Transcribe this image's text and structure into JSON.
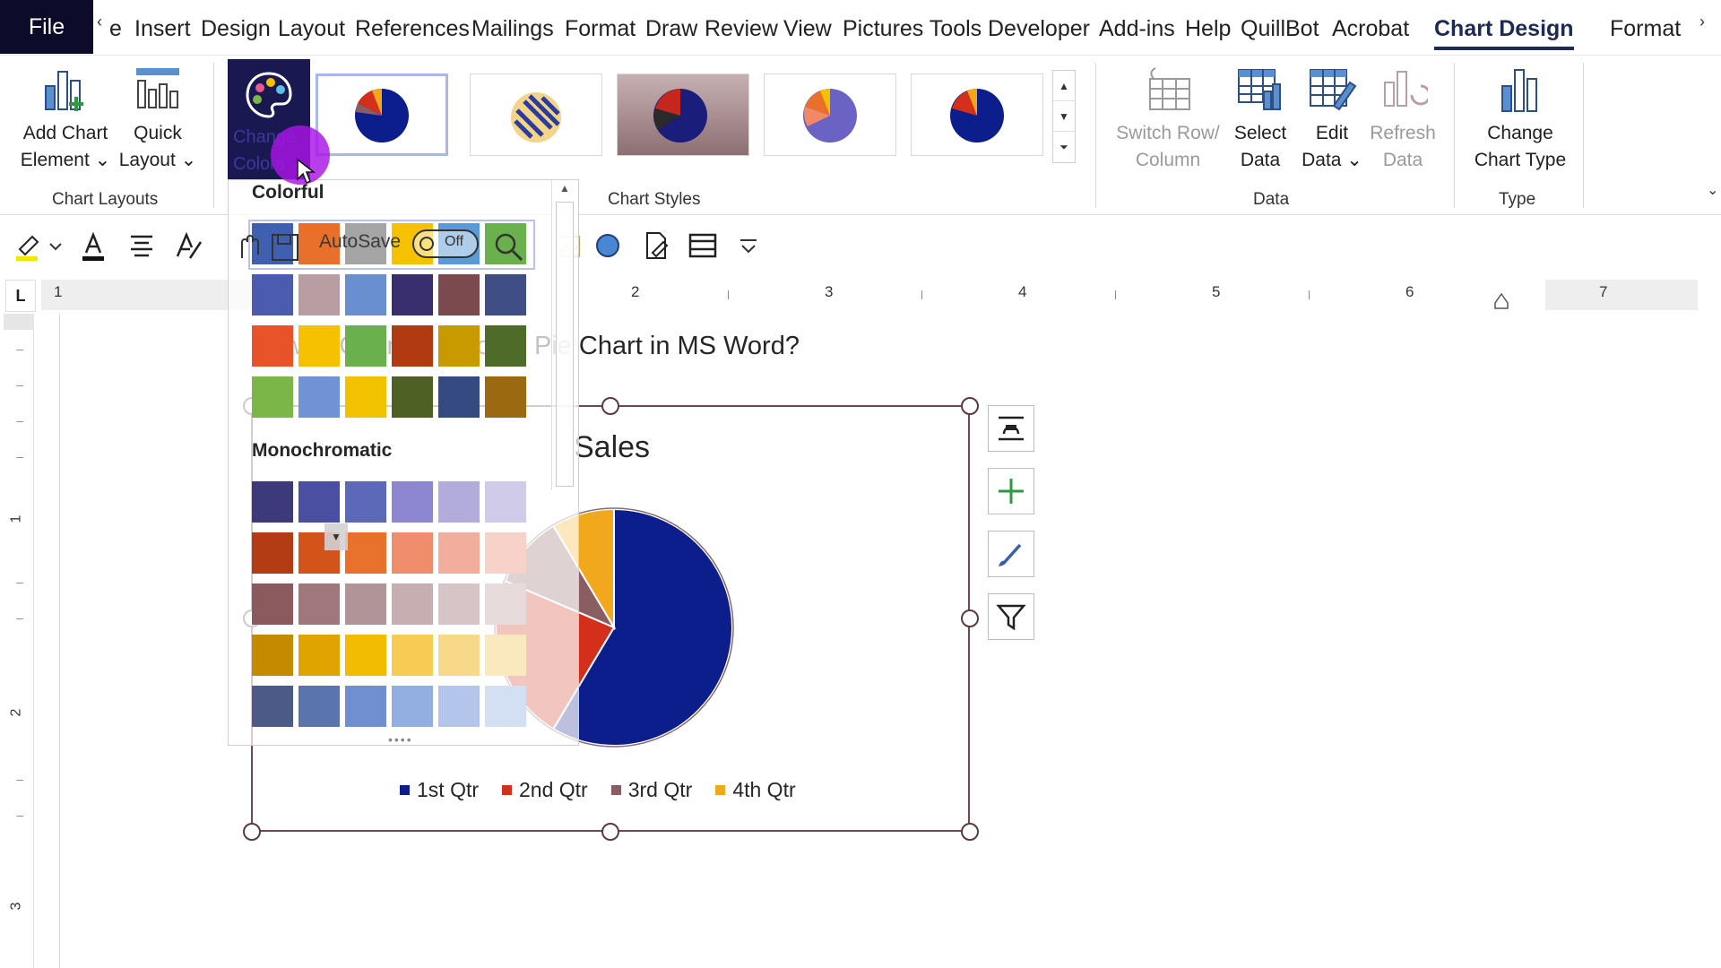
{
  "tabs": {
    "file": "File",
    "scroll_left": "‹",
    "scroll_right": "›",
    "items": [
      "e",
      "Insert",
      "Design",
      "Layout",
      "References",
      "Mailings",
      "Format",
      "Draw",
      "Review",
      "View",
      "Pictures Tools",
      "Developer",
      "Add-ins",
      "Help",
      "QuillBot",
      "Acrobat",
      "Chart Design",
      "Format"
    ],
    "active": "Chart Design"
  },
  "ribbon": {
    "chart_layouts": {
      "add_chart_element": [
        "Add Chart",
        "Element ⌄"
      ],
      "quick_layout": [
        "Quick",
        "Layout ⌄"
      ],
      "change_colors": [
        "Change",
        "Colors ⌄"
      ],
      "group_label": "Chart Layouts"
    },
    "chart_styles": {
      "group_label": "Chart Styles"
    },
    "data": {
      "switch_row_column": [
        "Switch Row/",
        "Column"
      ],
      "select_data": [
        "Select",
        "Data"
      ],
      "edit_data": [
        "Edit",
        "Data ⌄"
      ],
      "refresh_data": [
        "Refresh",
        "Data"
      ],
      "group_label": "Data"
    },
    "type": {
      "change_chart_type": [
        "Change",
        "Chart Type"
      ],
      "group_label": "Type"
    }
  },
  "quick_toolbar": {
    "autosave_label": "AutoSave",
    "autosave_state": "Off"
  },
  "ruler": {
    "corner": "L",
    "numbers": [
      "1",
      "1",
      "2",
      "3",
      "4",
      "5",
      "6",
      "7"
    ],
    "vertical_numbers": [
      "1",
      "2",
      "3"
    ]
  },
  "document": {
    "heading": "How to Change Color in Pie Chart in MS Word?"
  },
  "color_panel": {
    "colorful_heading": "Colorful",
    "monochromatic_heading": "Monochromatic",
    "colorful_rows": [
      [
        "#3f5fb0",
        "#e8702a",
        "#a5a5a5",
        "#f5c100",
        "#5a9ad6",
        "#6ab04c"
      ],
      [
        "#4b5bb0",
        "#b89ea2",
        "#6a8fd0",
        "#3a2f6e",
        "#7a4a4e",
        "#3f4f86"
      ],
      [
        "#e8532a",
        "#f5c100",
        "#6ab04c",
        "#b13a10",
        "#c89a00",
        "#4f6b2a"
      ],
      [
        "#7ab648",
        "#6f93d4",
        "#f2c200",
        "#4f6024",
        "#344a80",
        "#9b6a10"
      ]
    ],
    "mono_rows": [
      [
        "#3c3a7a",
        "#4b4fa2",
        "#5c68b8",
        "#8d86d0",
        "#b2acdc",
        "#cfcbe9"
      ],
      [
        "#b43c15",
        "#d2541b",
        "#e8712c",
        "#ef8d6c",
        "#f3ad9c",
        "#f6d2c8"
      ],
      [
        "#8a5a5f",
        "#a0787c",
        "#b19498",
        "#c6aeb1",
        "#d7c4c6",
        "#e6dadb"
      ],
      [
        "#c48b00",
        "#e0a400",
        "#f2bd00",
        "#f6cc52",
        "#f8d98a",
        "#fae8bf"
      ],
      [
        "#4c5a88",
        "#5a74ad",
        "#6f8fd0",
        "#93aee0",
        "#b3c5ea",
        "#d3dff3"
      ]
    ]
  },
  "chart_data": {
    "type": "pie",
    "title": "Sales",
    "categories": [
      "1st Qtr",
      "2nd Qtr",
      "3rd Qtr",
      "4th Qtr"
    ],
    "values": [
      8.2,
      3.2,
      1.4,
      1.2
    ],
    "colors": [
      "#0b1e8c",
      "#d32f1a",
      "#8a5d62",
      "#f2a81c"
    ],
    "legend_position": "bottom"
  }
}
